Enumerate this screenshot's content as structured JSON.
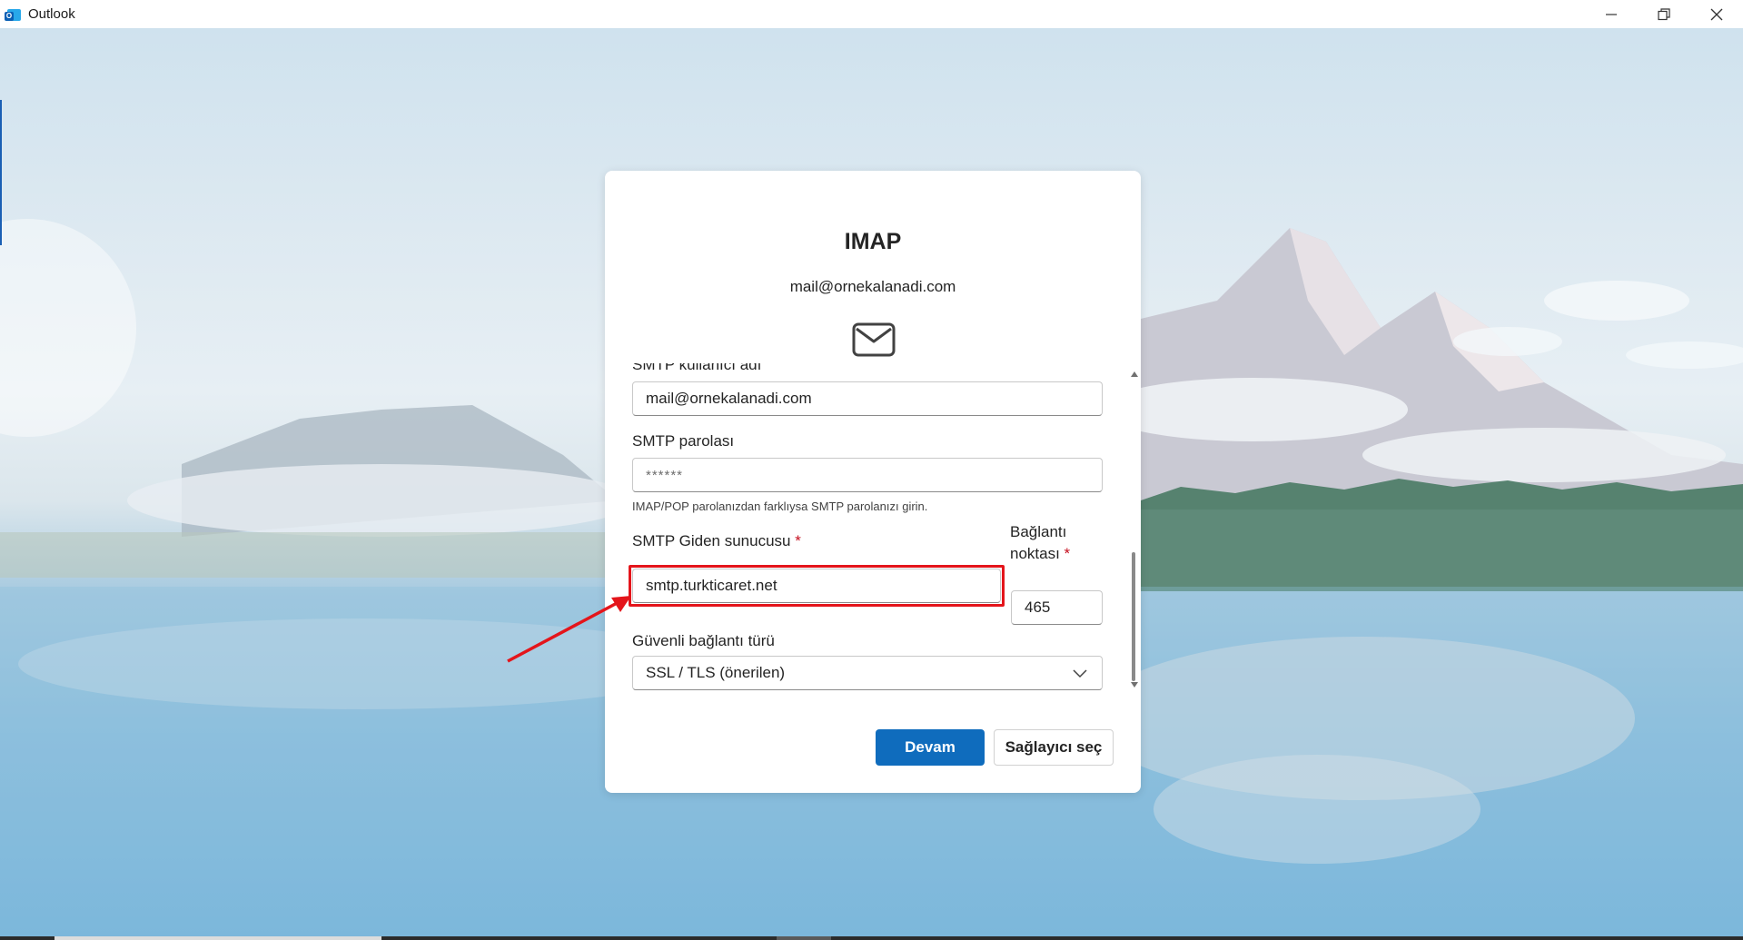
{
  "window": {
    "title": "Outlook",
    "app_icon_letter": "O"
  },
  "dialog": {
    "title": "IMAP",
    "email": "mail@ornekalanadi.com",
    "fields": {
      "smtp_username_label": "SMTP kullanıcı adı",
      "smtp_username_value": "mail@ornekalanadi.com",
      "smtp_password_label": "SMTP parolası",
      "smtp_password_value": "******",
      "smtp_password_helper": "IMAP/POP parolanızdan farklıysa SMTP parolanızı girin.",
      "smtp_server_label": "SMTP Giden sunucusu",
      "smtp_server_value": "smtp.turkticaret.net",
      "port_label_line1": "Bağlantı",
      "port_label_line2": "noktası",
      "port_value": "465",
      "security_label": "Güvenli bağlantı türü",
      "security_value": "SSL / TLS (önerilen)",
      "required_mark": "*"
    },
    "buttons": {
      "continue": "Devam",
      "choose_provider": "Sağlayıcı seç"
    }
  },
  "colors": {
    "primary": "#0f6cbd",
    "highlight": "#e4151b",
    "required": "#c50f1f"
  }
}
